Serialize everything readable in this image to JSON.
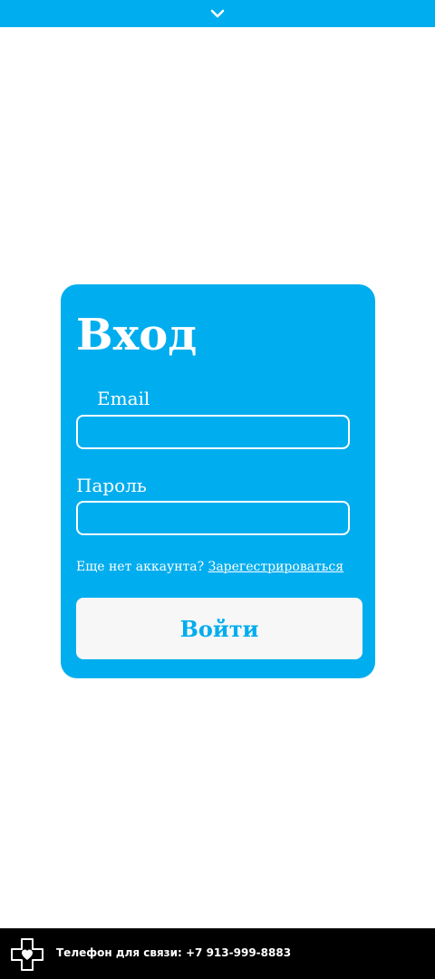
{
  "header": {
    "toggle_icon": "chevron-down-icon"
  },
  "login": {
    "title": "Вход",
    "email_label": "Email",
    "email_value": "",
    "password_label": "Пароль",
    "password_value": "",
    "no_account_text": "Еще нет аккаунта?",
    "register_link": "Зарегестрироваться",
    "submit_label": "Войти"
  },
  "footer": {
    "logo_icon": "medical-cross-heart-icon",
    "phone_text": "Телефон для связи: +7 913-999-8883"
  },
  "colors": {
    "accent": "#00adee",
    "button_bg": "#f7f7f7",
    "footer_bg": "#000000",
    "text_light": "#ffffff"
  }
}
